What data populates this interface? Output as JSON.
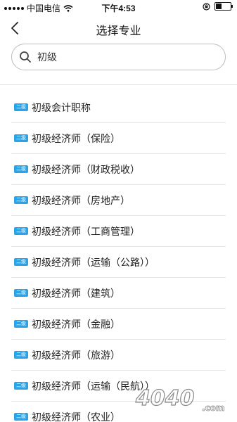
{
  "status_bar": {
    "carrier": "中国电信",
    "time": "下午4:53"
  },
  "nav": {
    "title": "选择专业"
  },
  "search": {
    "value": "初级"
  },
  "badge_label": "二级",
  "items": [
    {
      "label": "初级会计职称"
    },
    {
      "label": "初级经济师（保险）"
    },
    {
      "label": "初级经济师（财政税收）"
    },
    {
      "label": "初级经济师（房地产）"
    },
    {
      "label": "初级经济师（工商管理）"
    },
    {
      "label": "初级经济师（运输（公路））"
    },
    {
      "label": "初级经济师（建筑）"
    },
    {
      "label": "初级经济师（金融）"
    },
    {
      "label": "初级经济师（旅游）"
    },
    {
      "label": "初级经济师（运输（民航））"
    },
    {
      "label": "初级经济师（农业）"
    }
  ],
  "watermark": {
    "text": "4040",
    "suffix": ".com"
  }
}
